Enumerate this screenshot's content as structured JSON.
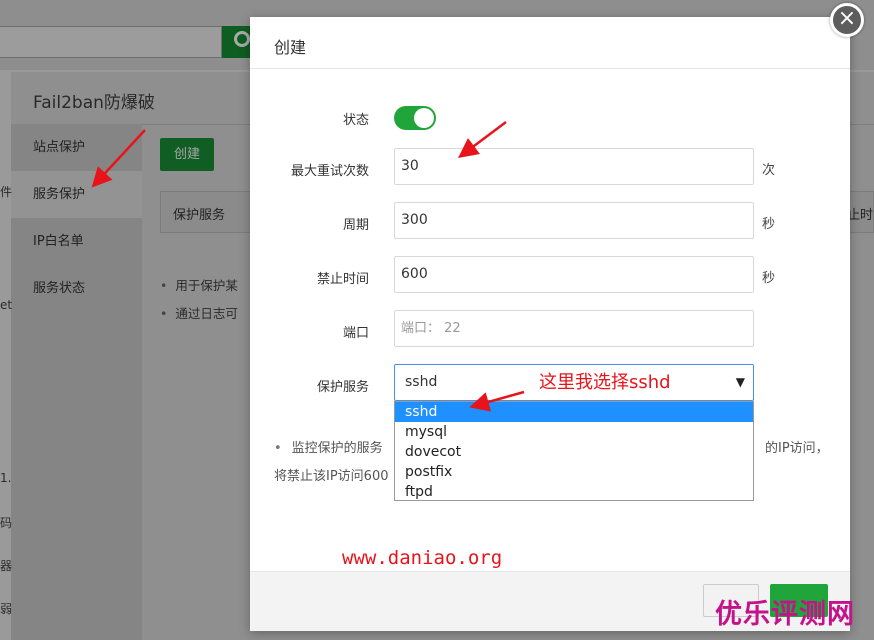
{
  "background": {
    "panel_title": "Fail2ban防爆破",
    "sidebar": [
      {
        "label": "站点保护"
      },
      {
        "label": "服务保护"
      },
      {
        "label": "IP白名单"
      },
      {
        "label": "服务状态"
      }
    ],
    "create_label": "创建",
    "table_header": "保护服务",
    "table_header_right": "止时",
    "notes": [
      "用于保护某",
      "通过日志可"
    ],
    "left_fragments": [
      "件",
      "et",
      "1.",
      "码",
      "器",
      "弱"
    ]
  },
  "dialog": {
    "title": "创建",
    "close_symbol": "×",
    "status_label": "状态",
    "status_on": true,
    "max_retry_label": "最大重试次数",
    "max_retry_value": "30",
    "max_retry_unit": "次",
    "period_label": "周期",
    "period_value": "300",
    "period_unit": "秒",
    "ban_time_label": "禁止时间",
    "ban_time_value": "600",
    "ban_time_unit": "秒",
    "port_label": "端口",
    "port_placeholder": "端口： 22",
    "service_label": "保护服务",
    "service_value": "sshd",
    "service_options": [
      "sshd",
      "mysql",
      "dovecot",
      "postfix",
      "ftpd"
    ],
    "note_line1_a": "监控保护的服务",
    "note_line1_b": "的IP访问，",
    "note_line2": "将禁止该IP访问600"
  },
  "annotation": "这里我选择sshd",
  "website": "www.daniao.org",
  "watermark": "优乐评测网",
  "colors": {
    "accent": "#20a53a",
    "annotation": "#e8141b",
    "select_highlight": "#1e90ff"
  }
}
